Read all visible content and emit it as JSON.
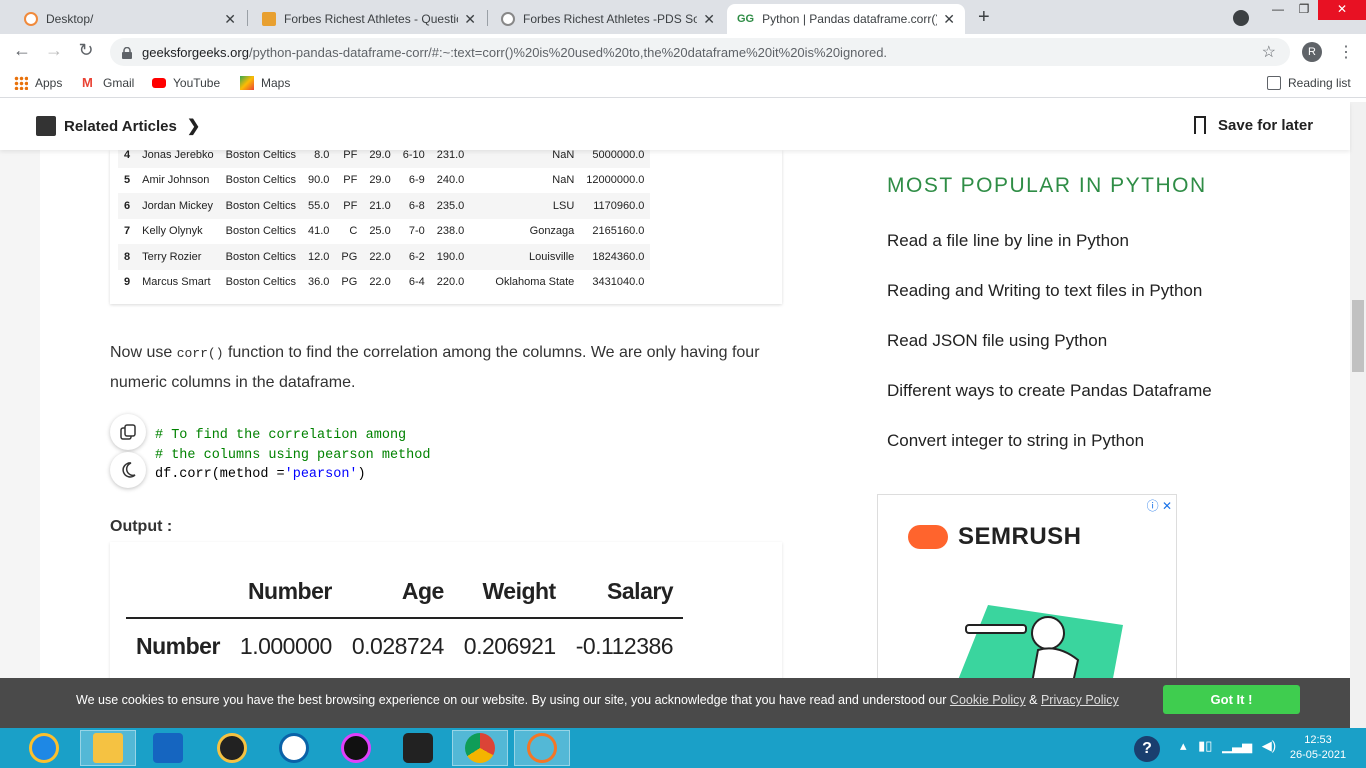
{
  "browser": {
    "tabs": [
      {
        "title": "Desktop/",
        "favicon_color": "#f08a3c",
        "active": false
      },
      {
        "title": "Forbes Richest Athletes - Questio",
        "favicon_color": "#e8a030",
        "active": false
      },
      {
        "title": "Forbes Richest Athletes -PDS Sol",
        "favicon_color": "#888888",
        "active": false
      },
      {
        "title": "Python | Pandas dataframe.corr()",
        "favicon_color": "#2f8d46",
        "active": true
      }
    ],
    "new_tab": "+",
    "url_domain": "geeksforgeeks.org",
    "url_path": "/python-pandas-dataframe-corr/#:~:text=corr()%20is%20used%20to,the%20dataframe%20it%20is%20ignored.",
    "profile_initial": "R",
    "bookmarks": [
      "Apps",
      "Gmail",
      "YouTube",
      "Maps"
    ],
    "reading_list": "Reading list"
  },
  "header": {
    "related_articles": "Related Articles",
    "save_for_later": "Save for later"
  },
  "data_table": {
    "rows": [
      [
        "4",
        "Jonas Jerebko",
        "Boston Celtics",
        "8.0",
        "PF",
        "29.0",
        "6-10",
        "231.0",
        "NaN",
        "5000000.0"
      ],
      [
        "5",
        "Amir Johnson",
        "Boston Celtics",
        "90.0",
        "PF",
        "29.0",
        "6-9",
        "240.0",
        "NaN",
        "12000000.0"
      ],
      [
        "6",
        "Jordan Mickey",
        "Boston Celtics",
        "55.0",
        "PF",
        "21.0",
        "6-8",
        "235.0",
        "LSU",
        "1170960.0"
      ],
      [
        "7",
        "Kelly Olynyk",
        "Boston Celtics",
        "41.0",
        "C",
        "25.0",
        "7-0",
        "238.0",
        "Gonzaga",
        "2165160.0"
      ],
      [
        "8",
        "Terry Rozier",
        "Boston Celtics",
        "12.0",
        "PG",
        "22.0",
        "6-2",
        "190.0",
        "Louisville",
        "1824360.0"
      ],
      [
        "9",
        "Marcus Smart",
        "Boston Celtics",
        "36.0",
        "PG",
        "22.0",
        "6-4",
        "220.0",
        "Oklahoma State",
        "3431040.0"
      ]
    ]
  },
  "article": {
    "para_before": "Now use ",
    "para_code": "corr()",
    "para_after": " function to find the correlation among the columns. We are only having four numeric columns in the dataframe.",
    "code_comment1": "# To find the correlation among",
    "code_comment2": "# the columns using pearson method",
    "code_line3_a": "df.corr(method =",
    "code_line3_str": "'pearson'",
    "code_line3_b": ")",
    "output_label": "Output :"
  },
  "output_table": {
    "headers": [
      "Number",
      "Age",
      "Weight",
      "Salary"
    ],
    "rows": [
      [
        "Number",
        "1.000000",
        "0.028724",
        "0.206921",
        "-0.112386"
      ]
    ]
  },
  "sidebar": {
    "title": "MOST POPULAR IN PYTHON",
    "items": [
      "Read a file line by line in Python",
      "Reading and Writing to text files in Python",
      "Read JSON file using Python",
      "Different ways to create Pandas Dataframe",
      "Convert integer to string in Python"
    ],
    "ad_brand": "SEMRUSH"
  },
  "cookie": {
    "message": "We use cookies to ensure you have the best browsing experience on our website. By using our site, you acknowledge that you have read and understood our ",
    "cookie_policy": "Cookie Policy",
    "amp": " & ",
    "privacy_policy": "Privacy Policy",
    "button": "Got It !"
  },
  "taskbar": {
    "time": "12:53",
    "date": "26-05-2021"
  }
}
